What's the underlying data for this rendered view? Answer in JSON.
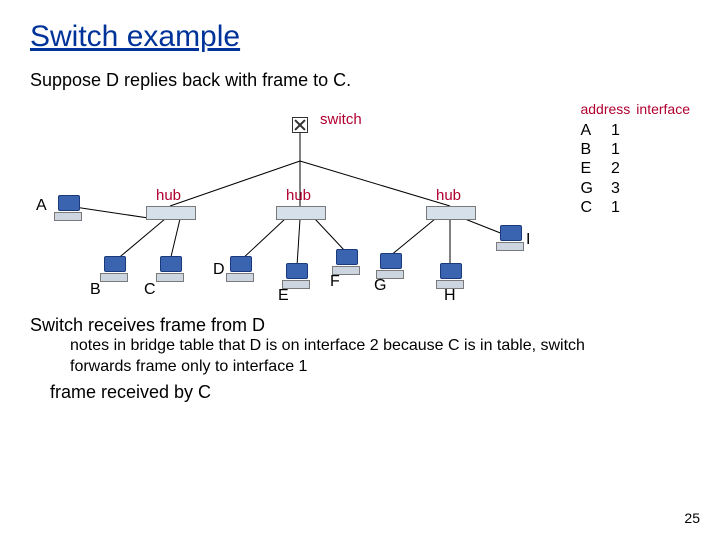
{
  "title": "Switch example",
  "subtitle": "Suppose D replies back with frame to C.",
  "labels": {
    "switch": "switch",
    "hub": "hub",
    "hosts": {
      "A": "A",
      "B": "B",
      "C": "C",
      "D": "D",
      "E": "E",
      "F": "F",
      "G": "G",
      "H": "H",
      "I": "I"
    }
  },
  "table": {
    "headers": {
      "addr": "address",
      "iface": "interface"
    },
    "rows": [
      {
        "addr": "A",
        "iface": "1"
      },
      {
        "addr": "B",
        "iface": "1"
      },
      {
        "addr": "E",
        "iface": "2"
      },
      {
        "addr": "G",
        "iface": "3"
      },
      {
        "addr": "C",
        "iface": "1"
      }
    ]
  },
  "footer": {
    "line1": "Switch receives frame from D",
    "line2": "notes in bridge table that D is on interface 2 because C is in table, switch forwards frame only to interface 1",
    "line3": "frame received by C"
  },
  "slidenum": "25",
  "chart_data": {
    "type": "diagram",
    "nodes": [
      {
        "id": "switch",
        "kind": "switch"
      },
      {
        "id": "hub1",
        "kind": "hub",
        "port": 1
      },
      {
        "id": "hub2",
        "kind": "hub",
        "port": 2
      },
      {
        "id": "hub3",
        "kind": "hub",
        "port": 3
      },
      {
        "id": "A",
        "kind": "host",
        "attached": "hub1"
      },
      {
        "id": "B",
        "kind": "host",
        "attached": "hub1"
      },
      {
        "id": "C",
        "kind": "host",
        "attached": "hub1"
      },
      {
        "id": "D",
        "kind": "host",
        "attached": "hub2"
      },
      {
        "id": "E",
        "kind": "host",
        "attached": "hub2"
      },
      {
        "id": "F",
        "kind": "host",
        "attached": "hub2"
      },
      {
        "id": "G",
        "kind": "host",
        "attached": "hub3"
      },
      {
        "id": "H",
        "kind": "host",
        "attached": "hub3"
      },
      {
        "id": "I",
        "kind": "host",
        "attached": "hub3"
      }
    ],
    "switch_table": [
      {
        "address": "A",
        "interface": 1
      },
      {
        "address": "B",
        "interface": 1
      },
      {
        "address": "E",
        "interface": 2
      },
      {
        "address": "G",
        "interface": 3
      },
      {
        "address": "C",
        "interface": 1
      }
    ]
  }
}
